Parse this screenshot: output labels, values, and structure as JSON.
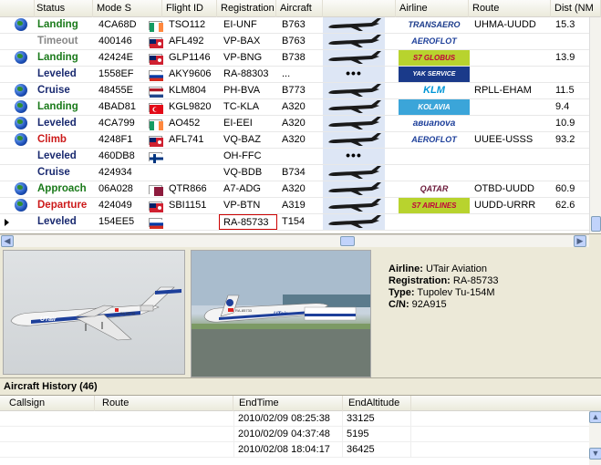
{
  "columns": {
    "status": "Status",
    "modes": "Mode S",
    "flight_id": "Flight ID",
    "registration": "Registration",
    "aircraft": "Aircraft",
    "airline": "Airline",
    "route": "Route",
    "dist": "Dist (NM"
  },
  "rows": [
    {
      "icon": "globe",
      "status": "Landing",
      "status_class": "landing",
      "modes": "4CA68D",
      "flag": "ireland",
      "flight_id": "TSO112",
      "registration": "EI-UNF",
      "aircraft": "B763",
      "thumb": "plane",
      "airline_logo": "TRANSAERO",
      "route": "UHMA-UUDD",
      "dist": "15.3"
    },
    {
      "icon": "",
      "status": "Timeout",
      "status_class": "timeout",
      "modes": "400146",
      "flag": "bermuda",
      "flight_id": "AFL492",
      "registration": "VP-BAX",
      "aircraft": "B763",
      "thumb": "plane",
      "airline_logo": "AEROFLOT",
      "route": "",
      "dist": ""
    },
    {
      "icon": "globe",
      "status": "Landing",
      "status_class": "landing",
      "modes": "42424E",
      "flag": "bermuda",
      "flight_id": "GLP1146",
      "registration": "VP-BNG",
      "aircraft": "B738",
      "thumb": "plane",
      "airline_logo": "S7 GLOBUS",
      "route": "",
      "dist": "13.9"
    },
    {
      "icon": "",
      "status": "Leveled",
      "status_class": "leveled",
      "modes": "1558EF",
      "flag": "russia",
      "flight_id": "AKY9606",
      "registration": "RA-88303",
      "aircraft": "...",
      "thumb": "dots",
      "airline_logo": "YAK SERVICE",
      "route": "",
      "dist": ""
    },
    {
      "icon": "globe",
      "status": "Cruise",
      "status_class": "cruise",
      "modes": "48455E",
      "flag": "netherlands",
      "flight_id": "KLM804",
      "registration": "PH-BVA",
      "aircraft": "B773",
      "thumb": "plane",
      "airline_logo": "KLM",
      "route": "RPLL-EHAM",
      "dist": "11.5"
    },
    {
      "icon": "globe",
      "status": "Landing",
      "status_class": "landing",
      "modes": "4BAD81",
      "flag": "turkey",
      "flight_id": "KGL9820",
      "registration": "TC-KLA",
      "aircraft": "A320",
      "thumb": "plane",
      "airline_logo": "KOLAVIA",
      "route": "",
      "dist": "9.4"
    },
    {
      "icon": "globe",
      "status": "Leveled",
      "status_class": "leveled",
      "modes": "4CA799",
      "flag": "ireland",
      "flight_id": "AO452",
      "registration": "EI-EEI",
      "aircraft": "A320",
      "thumb": "plane",
      "airline_logo": "авиаnova",
      "route": "",
      "dist": "10.9"
    },
    {
      "icon": "globe",
      "status": "Climb",
      "status_class": "climb",
      "modes": "4248F1",
      "flag": "bermuda",
      "flight_id": "AFL741",
      "registration": "VQ-BAZ",
      "aircraft": "A320",
      "thumb": "plane",
      "airline_logo": "AEROFLOT",
      "route": "UUEE-USSS",
      "dist": "93.2"
    },
    {
      "icon": "",
      "status": "Leveled",
      "status_class": "leveled",
      "modes": "460DB8",
      "flag": "finland",
      "flight_id": "",
      "registration": "OH-FFC",
      "aircraft": "",
      "thumb": "dots",
      "airline_logo": "",
      "route": "",
      "dist": ""
    },
    {
      "icon": "",
      "status": "Cruise",
      "status_class": "cruise",
      "modes": "424934",
      "flag": "",
      "flight_id": "",
      "registration": "VQ-BDB",
      "aircraft": "B734",
      "thumb": "plane",
      "airline_logo": "",
      "route": "",
      "dist": ""
    },
    {
      "icon": "globe",
      "status": "Approach",
      "status_class": "approach",
      "modes": "06A028",
      "flag": "qatar",
      "flight_id": "QTR866",
      "registration": "A7-ADG",
      "aircraft": "A320",
      "thumb": "plane",
      "airline_logo": "QATAR",
      "route": "OTBD-UUDD",
      "dist": "60.9"
    },
    {
      "icon": "globe",
      "status": "Departure",
      "status_class": "departure",
      "modes": "424049",
      "flag": "bermuda",
      "flight_id": "SBI1151",
      "registration": "VP-BTN",
      "aircraft": "A319",
      "thumb": "plane",
      "airline_logo": "S7 AIRLINES",
      "route": "UUDD-URRR",
      "dist": "62.6"
    },
    {
      "icon": "arrow",
      "status": "Leveled",
      "status_class": "leveled",
      "modes": "154EE5",
      "flag": "russia",
      "flight_id": "",
      "registration": "RA-85733",
      "aircraft": "T154",
      "thumb": "plane",
      "airline_logo": "",
      "route": "",
      "dist": ""
    }
  ],
  "photo_labels": {
    "photo1_livery": "UTair",
    "photo2_livery": "UTair",
    "photo1_reg": "RA-85733"
  },
  "details": {
    "airline_label": "Airline:",
    "airline": "UTair Aviation",
    "registration_label": "Registration:",
    "registration": "RA-85733",
    "type_label": "Type:",
    "type": "Tupolev Tu-154M",
    "cn_label": "C/N:",
    "cn": "92A915"
  },
  "history": {
    "title": "Aircraft History (46)",
    "columns": {
      "callsign": "Callsign",
      "route": "Route",
      "endtime": "EndTime",
      "endalt": "EndAltitude"
    },
    "rows": [
      {
        "callsign": "",
        "route": "",
        "endtime": "2010/02/09 08:25:38",
        "endalt": "33125"
      },
      {
        "callsign": "",
        "route": "",
        "endtime": "2010/02/09 04:37:48",
        "endalt": "5195"
      },
      {
        "callsign": "",
        "route": "",
        "endtime": "2010/02/08 18:04:17",
        "endalt": "36425"
      }
    ]
  },
  "colors": {
    "landing": "#1a7a1a",
    "climb": "#cc1a1a",
    "leveled": "#1a2a70",
    "timeout": "#888888",
    "selected_border": "#cc0000"
  }
}
